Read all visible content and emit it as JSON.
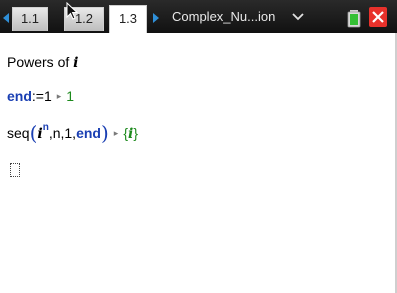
{
  "tabs": [
    {
      "label": "1.1"
    },
    {
      "label": "1.2"
    },
    {
      "label": "1.3"
    }
  ],
  "document_title": "Complex_Nu...ion",
  "colors": {
    "accent_blue": "#2f8fd8",
    "keyword_blue": "#1a3fb3",
    "result_green": "#1d8a1d",
    "close_red": "#e8312b",
    "battery_green": "#34c034"
  },
  "icons": {
    "left_arrow": "tab-scroll-left-icon",
    "right_arrow": "tab-scroll-right-icon",
    "menu": "chevron-down-icon",
    "battery": "battery-icon",
    "close": "close-icon",
    "cursor": "mouse-cursor-icon"
  },
  "content": {
    "heading_text": "Powers of ",
    "heading_var": "i",
    "end_line": {
      "keyword": "end",
      "assign": ":=1",
      "arrow": "▸",
      "result": "1"
    },
    "seq_line": {
      "func": "seq",
      "base": "i",
      "exponent": "n",
      "args": ",n,1,",
      "end_kw": "end",
      "arrow": "▸",
      "result_open": "{",
      "result_val": "i",
      "result_close": "}"
    }
  }
}
